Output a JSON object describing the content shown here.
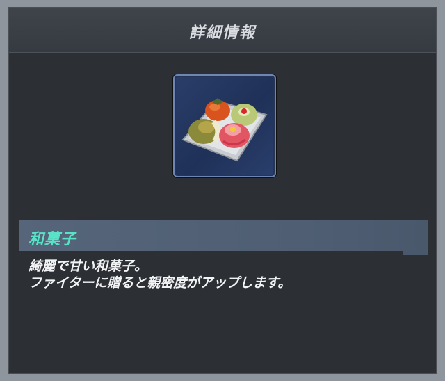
{
  "header": {
    "title": "詳細情報"
  },
  "item": {
    "icon": "wagashi-plate-icon",
    "name": "和菓子",
    "description_lines": [
      "綺麗で甘い和菓子。",
      "ファイターに贈ると親密度がアップします。"
    ]
  },
  "colors": {
    "item_name": "#58e3c8",
    "icon_frame_border": "#6f86b4",
    "name_bar": "#56657a",
    "panel_bg": "#2c2f34"
  }
}
